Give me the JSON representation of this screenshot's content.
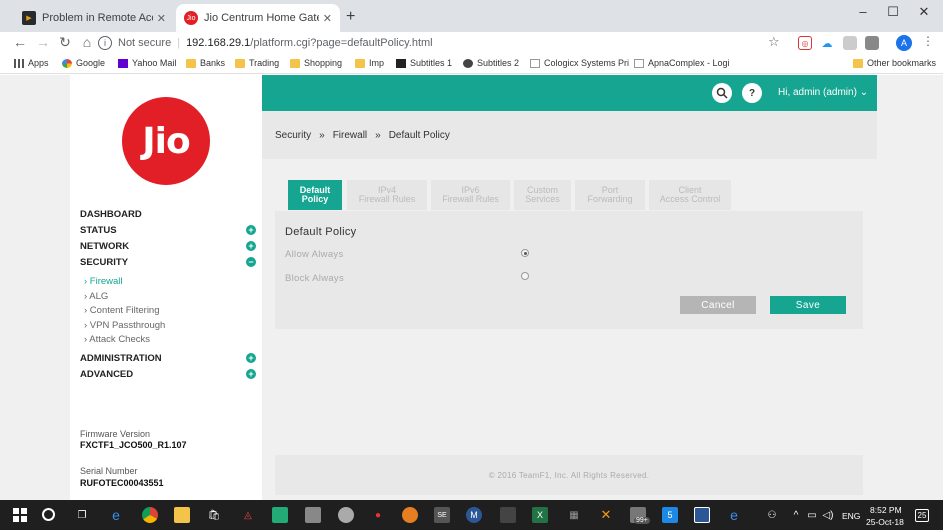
{
  "browser": {
    "tabs": [
      {
        "title": "Problem in Remote Access - Plex",
        "icon": "plex-icon"
      },
      {
        "title": "Jio Centrum Home Gateway :",
        "icon": "jio-icon"
      }
    ],
    "security_label": "Not secure",
    "url_host": "192.168.29.1",
    "url_path": "/platform.cgi?page=defaultPolicy.html",
    "profile_initial": "A"
  },
  "bookmarks": [
    {
      "label": "Apps",
      "icon": "apps-grid-icon"
    },
    {
      "label": "Google",
      "icon": "google-icon"
    },
    {
      "label": "Yahoo Mail",
      "icon": "yahoo-icon"
    },
    {
      "label": "Banks",
      "icon": "folder-icon"
    },
    {
      "label": "Trading",
      "icon": "folder-icon"
    },
    {
      "label": "Shopping",
      "icon": "folder-icon"
    },
    {
      "label": "Imp",
      "icon": "folder-icon"
    },
    {
      "label": "Subtitles 1",
      "icon": "subtitles-icon"
    },
    {
      "label": "Subtitles 2",
      "icon": "subtitles-icon"
    },
    {
      "label": "Cologicx Systems Pri",
      "icon": "page-icon"
    },
    {
      "label": "ApnaComplex - Logi",
      "icon": "page-icon"
    }
  ],
  "other_bookmarks": "Other bookmarks",
  "brand": {
    "logo_text": "Jio",
    "logo_color": "#e21e26",
    "accent": "#15a590"
  },
  "sidebar": {
    "sections": [
      {
        "label": "DASHBOARD",
        "toggle": ""
      },
      {
        "label": "STATUS",
        "toggle": "+"
      },
      {
        "label": "NETWORK",
        "toggle": "+"
      },
      {
        "label": "SECURITY",
        "toggle": "−"
      },
      {
        "label": "ADMINISTRATION",
        "toggle": "+"
      },
      {
        "label": "ADVANCED",
        "toggle": "+"
      }
    ],
    "security_items": [
      "› Firewall",
      "› ALG",
      "› Content Filtering",
      "› VPN Passthrough",
      "› Attack Checks"
    ],
    "firmware_label": "Firmware Version",
    "firmware_value": "FXCTF1_JCO500_R1.107",
    "serial_label": "Serial Number",
    "serial_value": "RUFOTEC00043551"
  },
  "header": {
    "help_label": "?",
    "user_label": "Hi, admin (admin)",
    "chevron": "⌄"
  },
  "breadcrumb": [
    "Security",
    "Firewall",
    "Default Policy"
  ],
  "breadcrumb_sep": "»",
  "tabs": [
    {
      "line1": "Default",
      "line2": "Policy"
    },
    {
      "line1": "IPv4",
      "line2": "Firewall Rules"
    },
    {
      "line1": "IPv6",
      "line2": "Firewall Rules"
    },
    {
      "line1": "Custom",
      "line2": "Services"
    },
    {
      "line1": "Port",
      "line2": "Forwarding"
    },
    {
      "line1": "Client",
      "line2": "Access Control"
    }
  ],
  "panel": {
    "title": "Default Policy",
    "options": [
      {
        "label": "Allow Always",
        "checked": true
      },
      {
        "label": "Block Always",
        "checked": false
      }
    ],
    "cancel_label": "Cancel",
    "save_label": "Save"
  },
  "footer": "© 2016 TeamF1, Inc. All Rights Reserved.",
  "taskbar": {
    "time": "8:52 PM",
    "date": "25-Oct-18",
    "lang": "ENG",
    "notif_count": "25",
    "badge": "99+"
  }
}
